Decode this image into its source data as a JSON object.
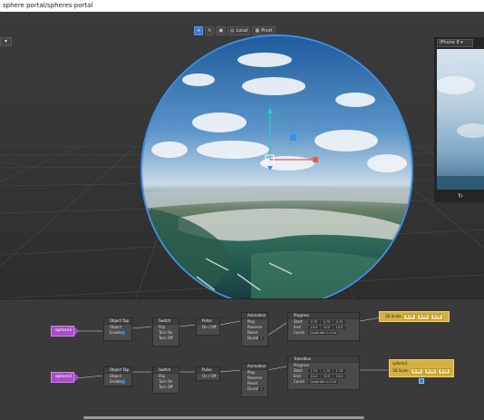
{
  "window": {
    "title": "sphere portal/spheres portal"
  },
  "viewport": {
    "left_dropdown": "▾",
    "toolbar": [
      {
        "name": "move-tool",
        "icon": "move-icon",
        "glyph": "✛",
        "label": "",
        "active": true
      },
      {
        "name": "rotate-tool",
        "icon": "rotate-icon",
        "glyph": "↻",
        "label": "",
        "active": false
      },
      {
        "name": "scale-tool",
        "icon": "scale-icon",
        "glyph": "▣",
        "label": "",
        "active": false
      },
      {
        "name": "local-toggle",
        "icon": "globe-icon",
        "glyph": "◎",
        "label": "Local",
        "active": false
      },
      {
        "name": "pivot-toggle",
        "icon": "pivot-icon",
        "glyph": "▦",
        "label": "Pivot",
        "active": false
      }
    ]
  },
  "device": {
    "name": "iPhone 8",
    "rotate_glyph": "↻"
  },
  "patch_editor": {
    "row1": {
      "input_label": "sphere2",
      "object_tap": {
        "title": "Object Tap",
        "rows": [
          "Object",
          "Enabled"
        ]
      },
      "switch": {
        "title": "Switch",
        "rows": [
          "Flip",
          "Turn On",
          "Turn Off"
        ]
      },
      "pulse": {
        "title": "Pulse",
        "rows": [
          "On / Off"
        ]
      },
      "animation": {
        "title": "Animation",
        "rows": [
          "Play",
          "Reverse",
          "Reset",
          "Duration"
        ],
        "duration": "1"
      },
      "progress": {
        "title": "Progress",
        "start_label": "Start",
        "end_label": "End",
        "curve_label": "Curve",
        "start": [
          "0.70",
          "0.70",
          "0.70"
        ],
        "end": [
          "10.0",
          "10.0",
          "10.0"
        ],
        "curve": "Quadratic In-Out"
      },
      "output": {
        "label": "3D Scale",
        "values": [
          "0.70",
          "0.70",
          "0.70"
        ]
      }
    },
    "row2": {
      "input_label": "sphere3",
      "object_tap": {
        "title": "Object Tap",
        "rows": [
          "Object",
          "Enabled"
        ]
      },
      "switch": {
        "title": "Switch",
        "rows": [
          "Flip",
          "Turn On",
          "Turn Off"
        ]
      },
      "pulse": {
        "title": "Pulse",
        "rows": [
          "On / Off"
        ]
      },
      "animation": {
        "title": "Animation",
        "rows": [
          "Play",
          "Reverse",
          "Reset",
          "Duration"
        ],
        "duration": "1"
      },
      "transition": {
        "title": "Transition",
        "progress_label": "Progress",
        "start_label": "Start",
        "end_label": "End",
        "curve_label": "Curve",
        "start": [
          "1.70",
          "1.70",
          "1.70"
        ],
        "end": [
          "10.0",
          "10.0",
          "10.0"
        ],
        "curve": "Quadratic In-Out"
      },
      "output": {
        "title": "sphere3",
        "label": "3D Scale",
        "values": [
          "0.70",
          "0.70",
          "0.70"
        ]
      }
    }
  },
  "colors": {
    "accent": "#3a7bd5",
    "patch_input": "#a64dc7",
    "patch_output": "#d4b041",
    "sphere_outline": "#3e8fe6"
  }
}
